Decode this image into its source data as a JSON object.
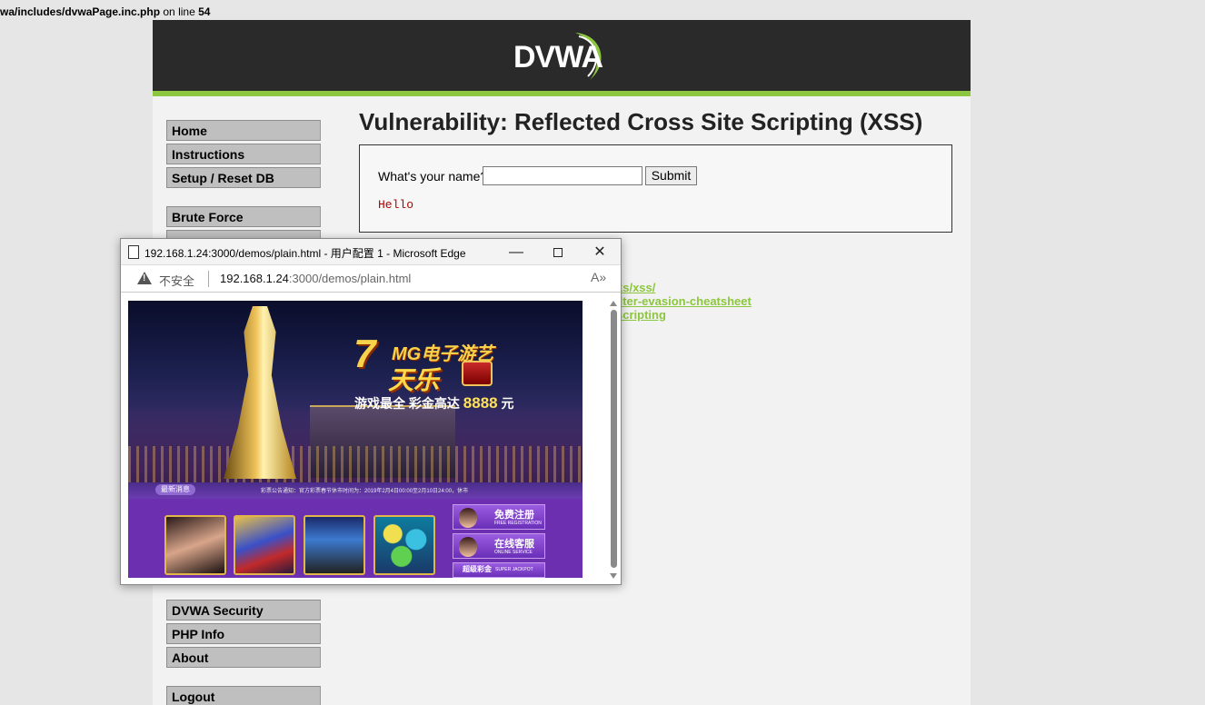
{
  "php_warning": {
    "path": "wa/includes/dvwaPage.inc.php",
    "middle": " on line ",
    "line": "54"
  },
  "header": {
    "logo_text": "DVWA",
    "accent_color": "#8dc63f"
  },
  "menu": {
    "group1": [
      "Home",
      "Instructions",
      "Setup / Reset DB"
    ],
    "group2_first": "Brute Force",
    "group3": [
      "DVWA Security",
      "PHP Info",
      "About"
    ],
    "logout": "Logout"
  },
  "main": {
    "title": "Vulnerability: Reflected Cross Site Scripting (XSS)",
    "form": {
      "label": "What's your name?",
      "input_value": "",
      "submit_label": "Submit"
    },
    "output": "Hello",
    "links": [
      "ks/xss/",
      "ilter-evasion-cheatsheet",
      "scripting"
    ]
  },
  "popup": {
    "window_title": "192.168.1.24:3000/demos/plain.html - 用户配置 1 - Microsoft Edge",
    "controls": {
      "minimize": "—",
      "close": "✕"
    },
    "address": {
      "security_label": "不安全",
      "url_host": "192.168.1.24",
      "url_rest": ":3000/demos/plain.html",
      "read_aloud": "A»"
    },
    "ad": {
      "seven": "7",
      "mg_title": "MG电子游艺",
      "big_title": "天乐",
      "sub_text": "游戏最全 彩金高达",
      "sub_amount": "8888",
      "sub_unit": "元",
      "news_tag": "最新消息",
      "notice": "彩票公告通知：官方彩票春节休市时间为：2019年2月4日00:00至2月10日24:00，休市",
      "side_buttons": [
        {
          "cn": "免费注册",
          "en": "FREE REGISTRATION"
        },
        {
          "cn": "在线客服",
          "en": "ONLINE SERVICE"
        },
        {
          "cn": "超级彩金",
          "en": "SUPER JACKPOT"
        }
      ]
    }
  }
}
